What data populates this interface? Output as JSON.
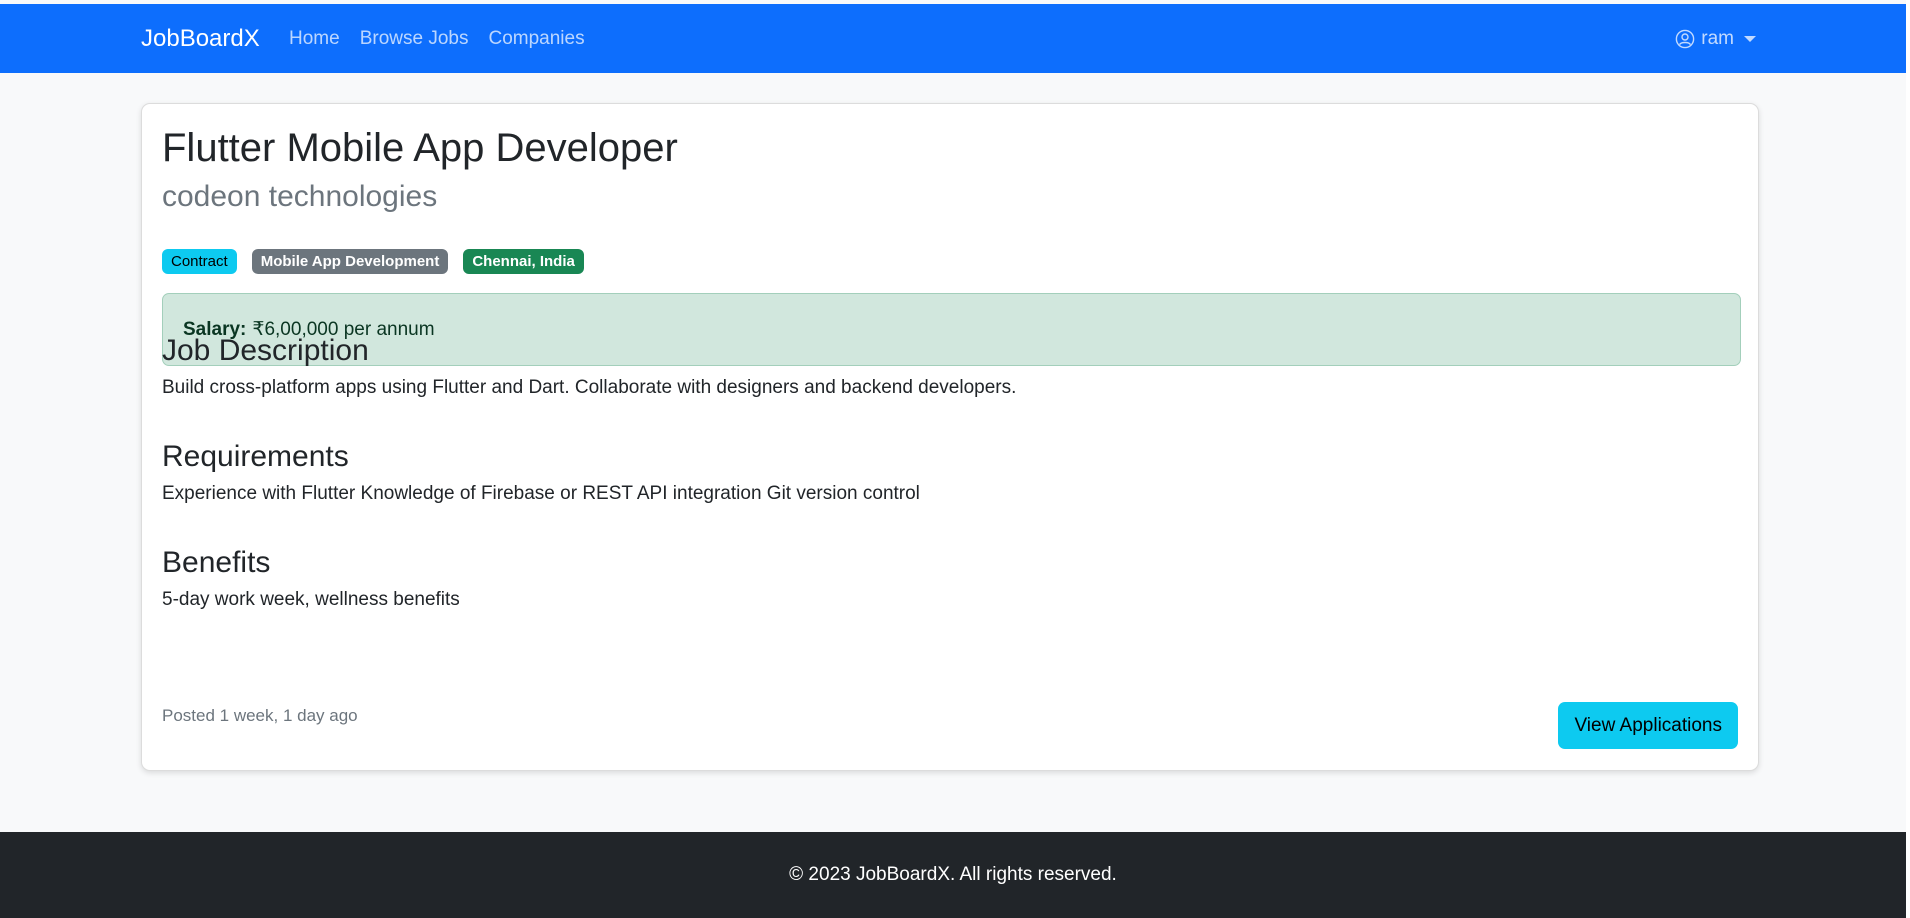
{
  "navbar": {
    "brand": "JobBoardX",
    "links": [
      "Home",
      "Browse Jobs",
      "Companies"
    ],
    "user": "ram"
  },
  "job": {
    "title": "Flutter Mobile App Developer",
    "company": "codeon technologies",
    "badges": [
      {
        "text": "Contract",
        "style": "info"
      },
      {
        "text": "Mobile App Development",
        "style": "secondary"
      },
      {
        "text": "Chennai, India",
        "style": "success"
      }
    ],
    "salary_label": "Salary:",
    "salary_value": "₹6,00,000 per annum",
    "description_heading": "Job Description",
    "description": "Build cross-platform apps using Flutter and Dart. Collaborate with designers and backend developers.",
    "requirements_heading": "Requirements",
    "requirements": "Experience with Flutter Knowledge of Firebase or REST API integration Git version control",
    "benefits_heading": "Benefits",
    "benefits": "5-day work week, wellness benefits",
    "posted": "Posted 1 week, 1 day ago",
    "action_label": "View Applications"
  },
  "footer": {
    "text": "© 2023 JobBoardX. All rights reserved."
  },
  "colors": {
    "primary": "#0d6efd",
    "info": "#0dcaf0",
    "secondary": "#6c757d",
    "success": "#198754",
    "salary_bg": "#d1e7dd",
    "footer_bg": "#212529"
  }
}
